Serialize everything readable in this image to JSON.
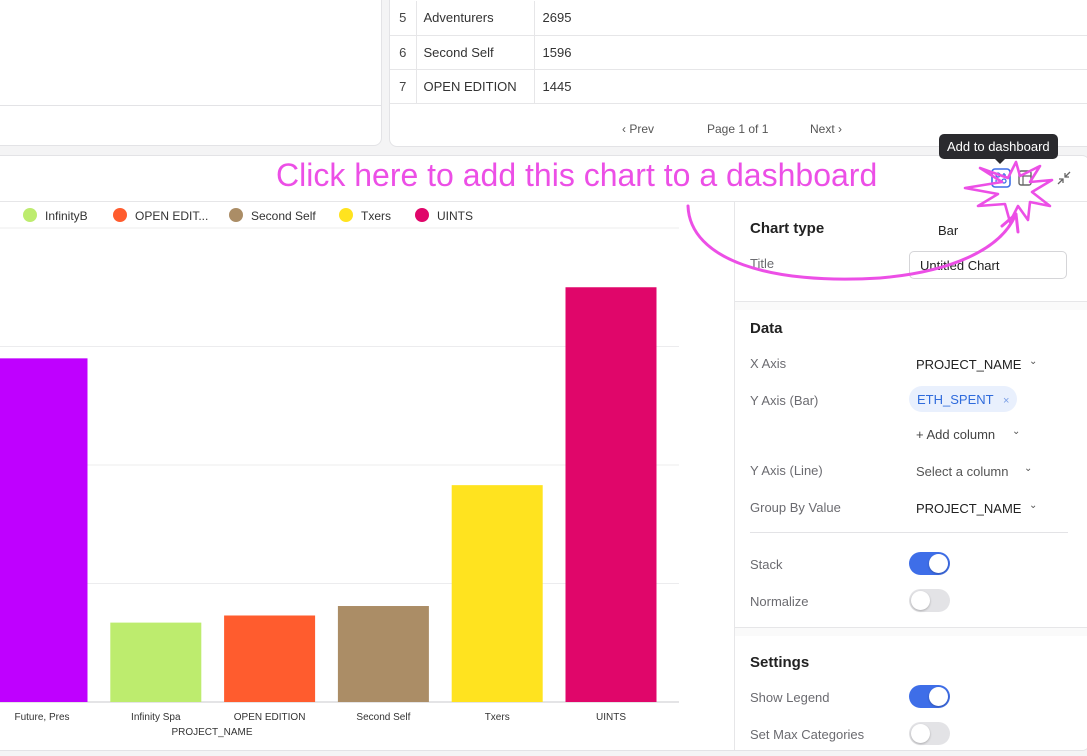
{
  "table": {
    "rows": [
      {
        "idx": "5",
        "name": "Adventurers",
        "value": "2695"
      },
      {
        "idx": "6",
        "name": "Second Self",
        "value": "1596"
      },
      {
        "idx": "7",
        "name": "OPEN EDITION",
        "value": "1445"
      }
    ],
    "pager": {
      "prev": "‹  Prev",
      "page": "Page 1 of 1",
      "next": "Next  ›"
    }
  },
  "annotation": {
    "text": "Click here to add this chart to a dashboard",
    "tooltip": "Add to dashboard"
  },
  "icons": {
    "add_to_dashboard": "dashboard-add-icon",
    "more": "sheet-icon",
    "collapse": "collapse-icon"
  },
  "legend": [
    {
      "name": "InfinityB",
      "color": "#bdec6e"
    },
    {
      "name": "OPEN EDIT...",
      "color": "#ff5c2e"
    },
    {
      "name": "Second Self",
      "color": "#ab8d66"
    },
    {
      "name": "Txers",
      "color": "#ffe31f"
    },
    {
      "name": "UINTS",
      "color": "#e0066a"
    }
  ],
  "chart_data": {
    "type": "bar",
    "stacked": true,
    "title": "",
    "xlabel": "PROJECT_NAME",
    "ylabel": "",
    "categories": [
      "Future, Pres",
      "Infinity Spa",
      "OPEN EDITION",
      "Second Self",
      "Txers",
      "UINTS"
    ],
    "values": [
      2900,
      670,
      730,
      810,
      1830,
      3500
    ],
    "colors": [
      "#bf00ff",
      "#bdec6e",
      "#ff5c2e",
      "#ab8d66",
      "#ffe31f",
      "#e0066a"
    ],
    "ylim": [
      0,
      4000
    ],
    "grid": true,
    "show_y_ticks": false,
    "legend_position": "top"
  },
  "settings": {
    "chart_type_label": "Chart type",
    "chart_type_value": "Bar",
    "title_label": "Title",
    "title_value": "Untitled Chart",
    "data_heading": "Data",
    "x_axis_label": "X Axis",
    "x_axis_value": "PROJECT_NAME",
    "y_axis_bar_label": "Y Axis (Bar)",
    "y_axis_bar_value": "ETH_SPENT",
    "remove_glyph": "×",
    "add_column": "+ Add column",
    "y_axis_line_label": "Y Axis (Line)",
    "y_axis_line_value": "Select a column",
    "group_by_label": "Group By Value",
    "group_by_value": "PROJECT_NAME",
    "stack_label": "Stack",
    "stack_on": true,
    "normalize_label": "Normalize",
    "normalize_on": false,
    "settings_heading": "Settings",
    "show_legend_label": "Show Legend",
    "show_legend_on": true,
    "max_categories_label": "Set Max Categories",
    "max_categories_on": false,
    "chevron": "⌄"
  },
  "colors": {
    "annotation": "#ec4fe6",
    "toggle_on": "#3e6ee8",
    "accent_blue": "#2f6bdc"
  }
}
